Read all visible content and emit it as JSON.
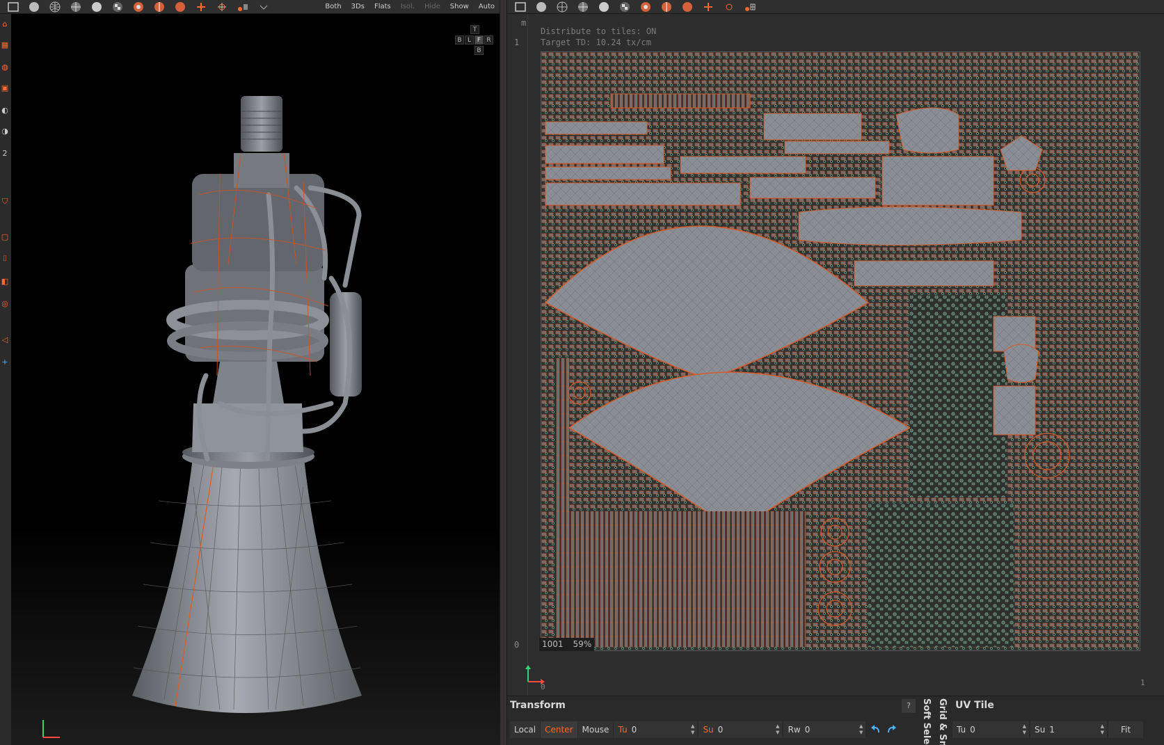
{
  "left_toolbar": {
    "modes": [
      {
        "label": "Both",
        "active": true
      },
      {
        "label": "3Ds",
        "active": false
      },
      {
        "label": "Flats",
        "active": false
      },
      {
        "label": "Isol.",
        "active": false,
        "dim": true
      },
      {
        "label": "Hide",
        "active": false,
        "dim": true
      },
      {
        "label": "Show",
        "active": false
      },
      {
        "label": "Auto",
        "active": false
      }
    ]
  },
  "view_cube": {
    "top": "T",
    "bottom": "B",
    "left": "L",
    "front": "F",
    "right": "R",
    "back": "B"
  },
  "uv_view": {
    "ruler_unit": "m",
    "ruler_top": "1",
    "ruler_bottom": "0",
    "ruler_h_start": "0",
    "ruler_h_end": "1",
    "info_line1": "Distribute to tiles: ON",
    "info_line2": "Target TD: 10.24 tx/cm",
    "tile_id": "1001",
    "tile_usage": "59%"
  },
  "transform_panel": {
    "title": "Transform",
    "help": "?",
    "buttons": [
      {
        "label": "Local",
        "active": false
      },
      {
        "label": "Center",
        "active": true
      },
      {
        "label": "Mouse",
        "active": false
      }
    ],
    "fields": [
      {
        "label": "Tu",
        "value": "0",
        "red": true
      },
      {
        "label": "Su",
        "value": "0",
        "red": true
      },
      {
        "label": "Rw",
        "value": "0",
        "red": false
      }
    ]
  },
  "side_tabs": {
    "soft_select": "Soft Selec",
    "grid_snap": "Grid & Sn"
  },
  "uv_tile_panel": {
    "title": "UV Tile",
    "fields": [
      {
        "label": "Tu",
        "value": "0"
      },
      {
        "label": "Su",
        "value": "1"
      }
    ],
    "fit_label": "Fit"
  },
  "colors": {
    "accent": "#ff6a2a",
    "panel_bg": "#2a2a2a",
    "viewport_bg": "#000000",
    "mesh": "#8a8e94",
    "uv_green": "#6fc590"
  }
}
